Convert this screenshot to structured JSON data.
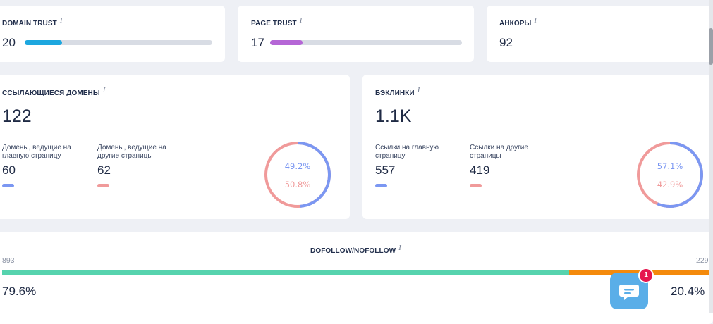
{
  "domain_trust": {
    "label": "DOMAIN TRUST",
    "info": "i",
    "value": "20",
    "percent": 20,
    "color": "#1da7df"
  },
  "page_trust": {
    "label": "PAGE TRUST",
    "info": "i",
    "value": "17",
    "percent": 17,
    "color": "#b566d6"
  },
  "anchors": {
    "label": "АНКОРЫ",
    "info": "i",
    "value": "92"
  },
  "ref_domains": {
    "label": "ССЫЛАЮЩИЕСЯ ДОМЕНЫ",
    "info": "i",
    "value": "122",
    "home": {
      "label_line1": "Домены, ведущие на",
      "label_line2": "главную страницу",
      "value": "60",
      "color": "#7b97f2"
    },
    "other": {
      "label_line1": "Домены, ведущие на",
      "label_line2": "другие страницы",
      "value": "62",
      "color": "#f09a9a"
    },
    "donut": {
      "home_pct": 49.2,
      "other_pct": 50.8,
      "home_label": "49.2%",
      "other_label": "50.8%"
    }
  },
  "backlinks": {
    "label": "БЭКЛИНКИ",
    "info": "i",
    "value": "1.1K",
    "home": {
      "label_line1": "Ссылки на главную",
      "label_line2": "страницу",
      "value": "557",
      "color": "#7b97f2"
    },
    "other": {
      "label_line1": "Ссылки на другие",
      "label_line2": "страницы",
      "value": "419",
      "color": "#f09a9a"
    },
    "donut": {
      "home_pct": 57.1,
      "other_pct": 42.9,
      "home_label": "57.1%",
      "other_label": "42.9%"
    }
  },
  "dofollow": {
    "label": "DOFOLLOW/NOFOLLOW",
    "info": "i",
    "left_count": "893",
    "right_count": "229",
    "left_pct": "79.6%",
    "right_pct": "20.4%",
    "left_ratio": 79.6,
    "left_color": "#56d3ae",
    "right_color": "#f48a0c"
  },
  "chat": {
    "badge": "1"
  }
}
